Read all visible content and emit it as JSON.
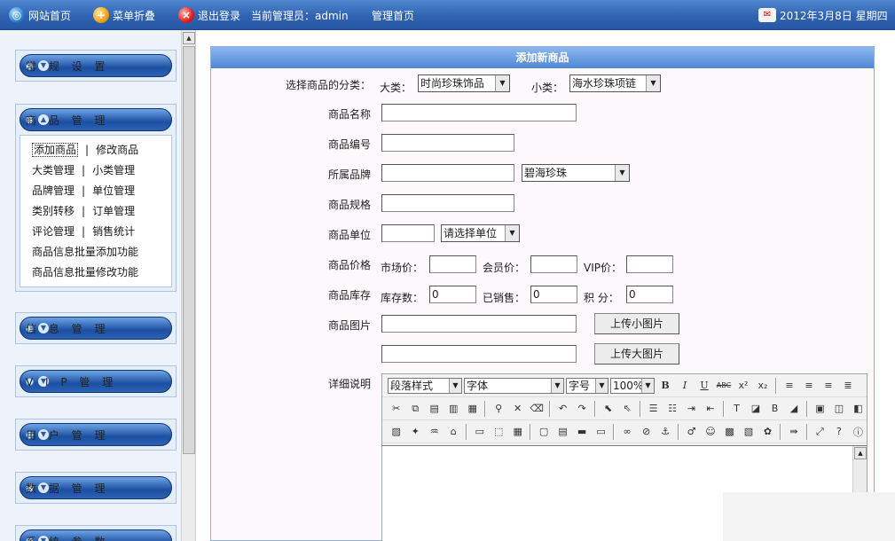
{
  "topbar": {
    "home": "网站首页",
    "collapse": "菜单折叠",
    "logout": "退出登录",
    "current_admin": "当前管理员：admin",
    "admin_home": "管理首页",
    "date": "2012年3月8日 星期四"
  },
  "sidebar": {
    "groups": [
      {
        "label": "常 规 设 置"
      },
      {
        "label": "商 品 管 理"
      },
      {
        "label": "信 息 管 理"
      },
      {
        "label": "V I P 管 理"
      },
      {
        "label": "用 户 管 理"
      },
      {
        "label": "数 据 管 理"
      },
      {
        "label": "系 统 参 数"
      }
    ],
    "links": [
      [
        "添加商品",
        "修改商品"
      ],
      [
        "大类管理",
        "小类管理"
      ],
      [
        "品牌管理",
        "单位管理"
      ],
      [
        "类别转移",
        "订单管理"
      ],
      [
        "评论管理",
        "销售统计"
      ]
    ],
    "links_single": [
      "商品信息批量添加功能",
      "商品信息批量修改功能"
    ],
    "separator": "|"
  },
  "form": {
    "title": "添加新商品",
    "category_label": "选择商品的分类：",
    "big_label": "大类：",
    "big_value": "时尚珍珠饰品",
    "small_label": "小类：",
    "small_value": "海水珍珠项链",
    "name_label": "商品名称",
    "code_label": "商品编号",
    "brand_label": "所属品牌",
    "brand_value": "碧海珍珠",
    "spec_label": "商品规格",
    "unit_label": "商品单位",
    "unit_value": "请选择单位",
    "price_label": "商品价格",
    "market_label": "市场价：",
    "member_label": "会员价：",
    "vip_label": "VIP价：",
    "stock_label": "商品库存",
    "stock_count_label": "库存数：",
    "stock_count": "0",
    "sold_label": "已销售：",
    "sold": "0",
    "points_label": "积 分：",
    "points": "0",
    "image_label": "商品图片",
    "upload_small": "上传小图片",
    "upload_big": "上传大图片",
    "detail_label": "详细说明"
  },
  "editor": {
    "paragraph": "段落样式",
    "font": "字体",
    "size": "字号",
    "zoom": "100%"
  }
}
